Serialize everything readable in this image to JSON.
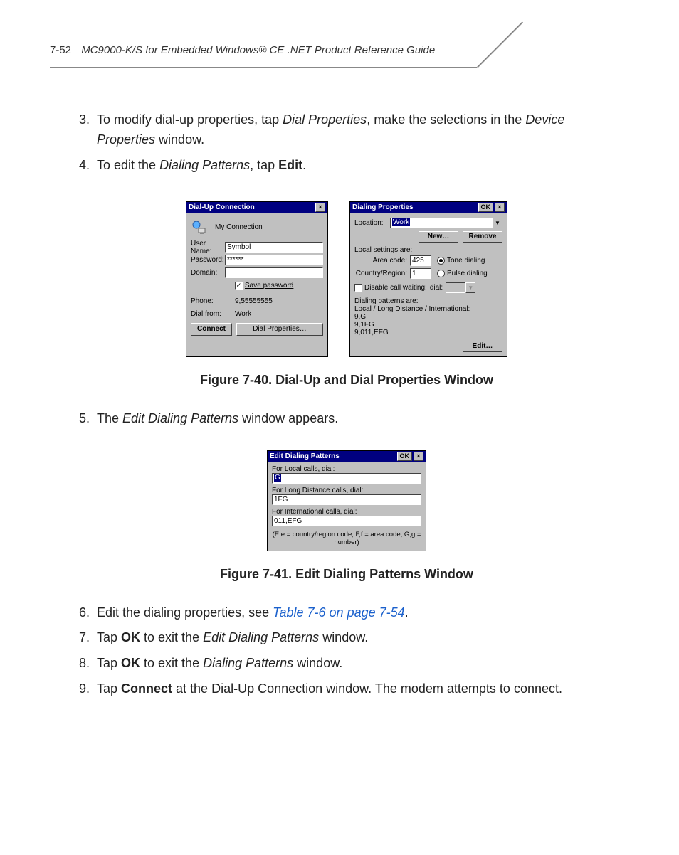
{
  "header": {
    "page_num": "7-52",
    "guide_title": "MC9000-K/S for Embedded Windows® CE .NET Product Reference Guide"
  },
  "steps": {
    "s3": {
      "num": "3.",
      "a": "To modify dial-up properties, tap ",
      "b": "Dial Properties",
      "c": ", make the selections in the ",
      "d": "Device Properties",
      "e": " window."
    },
    "s4": {
      "num": "4.",
      "a": "To edit the ",
      "b": "Dialing Patterns",
      "c": ", tap ",
      "d": "Edit",
      "e": "."
    },
    "s5": {
      "num": "5.",
      "a": "The ",
      "b": "Edit Dialing Patterns",
      "c": " window appears."
    },
    "s6": {
      "num": "6.",
      "a": "Edit the dialing properties, see ",
      "link": "Table 7-6 on page 7-54",
      "b": "."
    },
    "s7": {
      "num": "7.",
      "a": "Tap ",
      "b": "OK",
      "c": " to exit the ",
      "d": "Edit Dialing Patterns",
      "e": " window."
    },
    "s8": {
      "num": "8.",
      "a": "Tap ",
      "b": "OK",
      "c": " to exit the ",
      "d": "Dialing Patterns",
      "e": " window."
    },
    "s9": {
      "num": "9.",
      "a": "Tap ",
      "b": "Connect",
      "c": " at the Dial-Up Connection window. The modem attempts to connect."
    }
  },
  "captions": {
    "fig40": "Figure 7-40.  Dial-Up and Dial Properties Window",
    "fig41": "Figure 7-41.  Edit Dialing Patterns Window"
  },
  "dialup": {
    "title": "Dial-Up Connection",
    "close": "×",
    "conn_name": "My Connection",
    "user_label": "User Name:",
    "user_value": "Symbol",
    "pass_label": "Password:",
    "pass_value": "******",
    "domain_label": "Domain:",
    "domain_value": "",
    "save_pw": "Save password",
    "save_pw_check": "✓",
    "phone_label": "Phone:",
    "phone_value": "9,55555555",
    "dialfrom_label": "Dial from:",
    "dialfrom_value": "Work",
    "connect_btn": "Connect",
    "props_btn": "Dial Properties…"
  },
  "dialprops": {
    "title": "Dialing Properties",
    "ok": "OK",
    "close": "×",
    "location_label": "Location:",
    "location_value": "Work",
    "new_btn": "New…",
    "remove_btn": "Remove",
    "local_settings": "Local settings are:",
    "area_label": "Area code:",
    "area_value": "425",
    "tone": "Tone dialing",
    "country_label": "Country/Region:",
    "country_value": "1",
    "pulse": "Pulse dialing",
    "disable_cw": "Disable call waiting;",
    "dial_label": "dial:",
    "patterns_are": "Dialing patterns are:",
    "patterns_sub": "Local / Long Distance / International:",
    "p1": "9,G",
    "p2": "9,1FG",
    "p3": "9,011,EFG",
    "edit_btn": "Edit…"
  },
  "editpat": {
    "title": "Edit Dialing Patterns",
    "ok": "OK",
    "close": "×",
    "local_label": "For Local calls, dial:",
    "local_value": "G",
    "ld_label": "For Long Distance calls, dial:",
    "ld_value": "1FG",
    "intl_label": "For International calls, dial:",
    "intl_value": "011,EFG",
    "legend": "(E,e = country/region code; F,f = area code; G,g = number)"
  }
}
